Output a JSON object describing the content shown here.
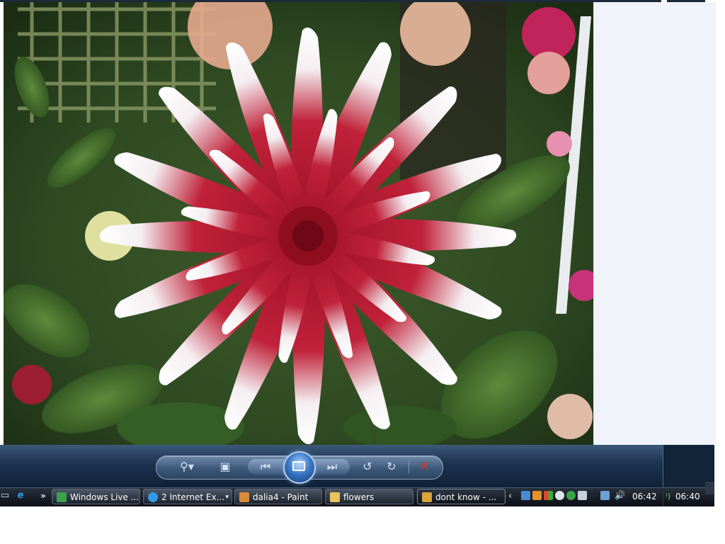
{
  "viewer": {
    "photo_subject": "",
    "toolbar": {
      "zoom_icon": "magnifier-zoom-icon",
      "fit_icon": "actual-size-icon",
      "prev_icon": "previous-icon",
      "play_icon": "slideshow-icon",
      "next_icon": "next-icon",
      "rotate_left_icon": "rotate-counterclockwise-icon",
      "rotate_right_icon": "rotate-clockwise-icon",
      "delete_icon": "delete-icon",
      "zoom_glyph": "⚲▾",
      "fit_glyph": "▣",
      "prev_glyph": "⏮",
      "next_glyph": "⏭",
      "rotl_glyph": "↺",
      "rotr_glyph": "↻",
      "delete_glyph": "✕"
    }
  },
  "taskbar": {
    "quick_launch": {
      "desktop_glyph": "▭",
      "ie_glyph": "e",
      "more_glyph": "»"
    },
    "tasks": [
      {
        "label": "Windows Live ...",
        "icon": "messenger-icon",
        "icon_color": "#3aa34a"
      },
      {
        "label": "2 Internet Ex...",
        "icon": "internet-explorer-icon",
        "icon_color": "#2f9be8",
        "arrow": "▾"
      },
      {
        "label": "dalia4 - Paint",
        "icon": "paint-icon",
        "icon_color": "#d88a3a"
      },
      {
        "label": "flowers",
        "icon": "folder-icon",
        "icon_color": "#e8c45a"
      },
      {
        "label": "dont know - ...",
        "icon": "photo-gallery-icon",
        "icon_color": "#d9a43a"
      }
    ],
    "tray": {
      "chevron": "‹",
      "clock": "06:42"
    },
    "secondary_clock": "06:40",
    "secondary_icon_glyph": "⁾)"
  },
  "colors": {
    "control_bar": "#1e3552",
    "taskbar": "#0b0f16",
    "delete_red": "#e0302a",
    "accent_blue": "#3a78c6"
  }
}
